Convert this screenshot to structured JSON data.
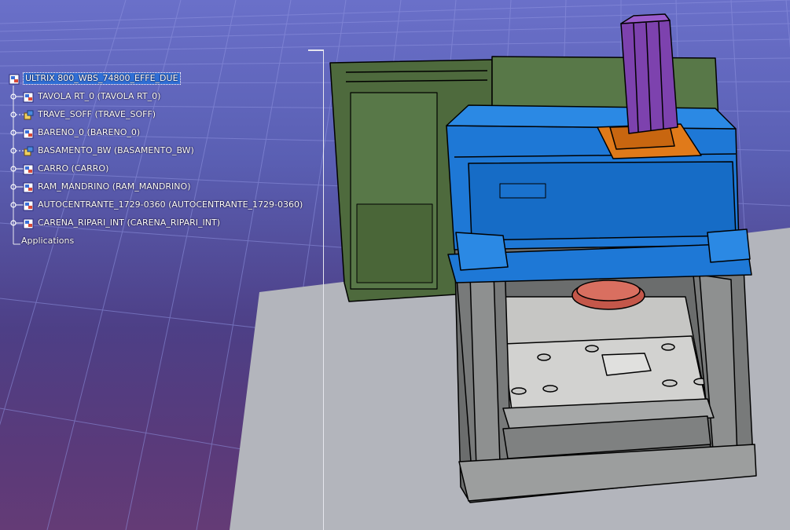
{
  "tree": {
    "root_label": "ULTRIX 800_WBS_74800_EFFE_DUE",
    "items": [
      {
        "label": "TAVOLA RT_0 (TAVOLA RT_0)",
        "icon": "product-icon"
      },
      {
        "label": "TRAVE_SOFF (TRAVE_SOFF)",
        "icon": "component-icon"
      },
      {
        "label": "BARENO_0 (BARENO_0)",
        "icon": "product-icon"
      },
      {
        "label": "BASAMENTO_BW (BASAMENTO_BW)",
        "icon": "component-icon"
      },
      {
        "label": "CARRO (CARRO)",
        "icon": "product-icon"
      },
      {
        "label": "RAM_MANDRINO (RAM_MANDRINO)",
        "icon": "product-icon"
      },
      {
        "label": "AUTOCENTRANTE_1729-0360 (AUTOCENTRANTE_1729-0360)",
        "icon": "product-icon"
      },
      {
        "label": "CARENA_RIPARI_INT (CARENA_RIPARI_INT)",
        "icon": "product-icon"
      }
    ],
    "applications_label": "Applications"
  },
  "colors": {
    "selection": "#2f6fd6",
    "background_top": "#6a70c9",
    "background_bottom": "#643b76",
    "floor": "#b3b5bc",
    "frame": "#6b6d6d",
    "blue_parts": "#1e78d6",
    "green_parts": "#4d6a3a",
    "spindle": "#7d42ae",
    "carriage": "#e07a1a"
  }
}
